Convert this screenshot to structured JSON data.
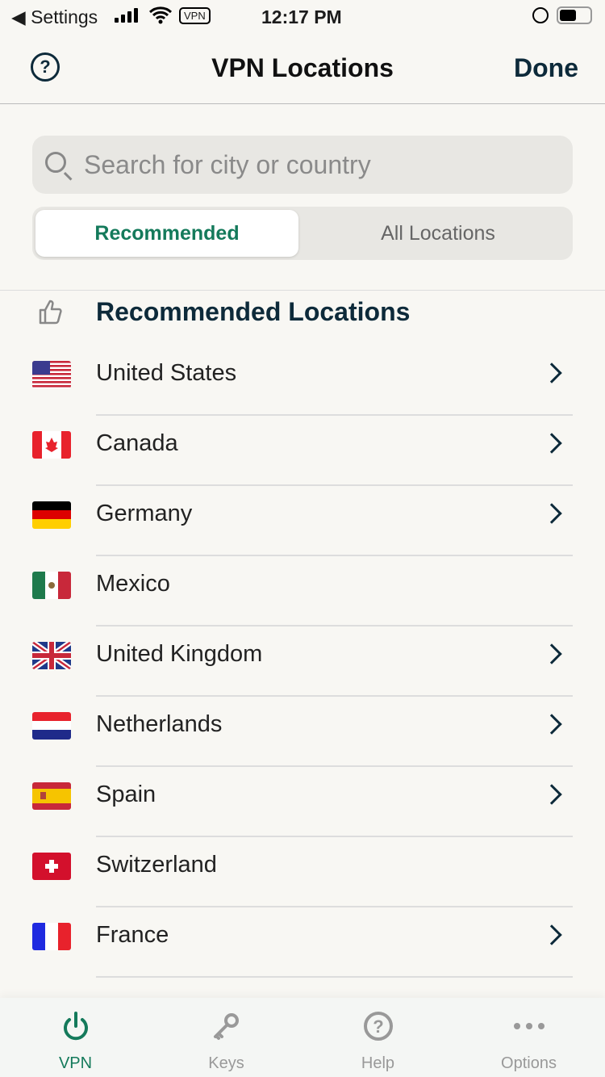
{
  "status_bar": {
    "back_label": "◀ Settings",
    "vpn_badge": "VPN",
    "time": "12:17 PM"
  },
  "nav": {
    "title": "VPN Locations",
    "done_label": "Done",
    "help_icon": "question-circle-icon"
  },
  "search": {
    "placeholder": "Search for city or country",
    "value": ""
  },
  "segments": {
    "recommended": "Recommended",
    "all": "All Locations",
    "selected": "Recommended"
  },
  "section": {
    "title": "Recommended Locations",
    "icon": "thumbs-up-icon"
  },
  "locations": [
    {
      "name": "United States",
      "has_chevron": true
    },
    {
      "name": "Canada",
      "has_chevron": true
    },
    {
      "name": "Germany",
      "has_chevron": true
    },
    {
      "name": "Mexico",
      "has_chevron": false
    },
    {
      "name": "United Kingdom",
      "has_chevron": true
    },
    {
      "name": "Netherlands",
      "has_chevron": true
    },
    {
      "name": "Spain",
      "has_chevron": true
    },
    {
      "name": "Switzerland",
      "has_chevron": false
    },
    {
      "name": "France",
      "has_chevron": true
    }
  ],
  "tabs": [
    {
      "label": "VPN",
      "icon": "power-icon"
    },
    {
      "label": "Keys",
      "icon": "key-icon"
    },
    {
      "label": "Help",
      "icon": "question-circle-icon"
    },
    {
      "label": "Options",
      "icon": "more-dots-icon"
    }
  ],
  "colors": {
    "accent": "#147a5b",
    "dark": "#0d2a3a"
  }
}
